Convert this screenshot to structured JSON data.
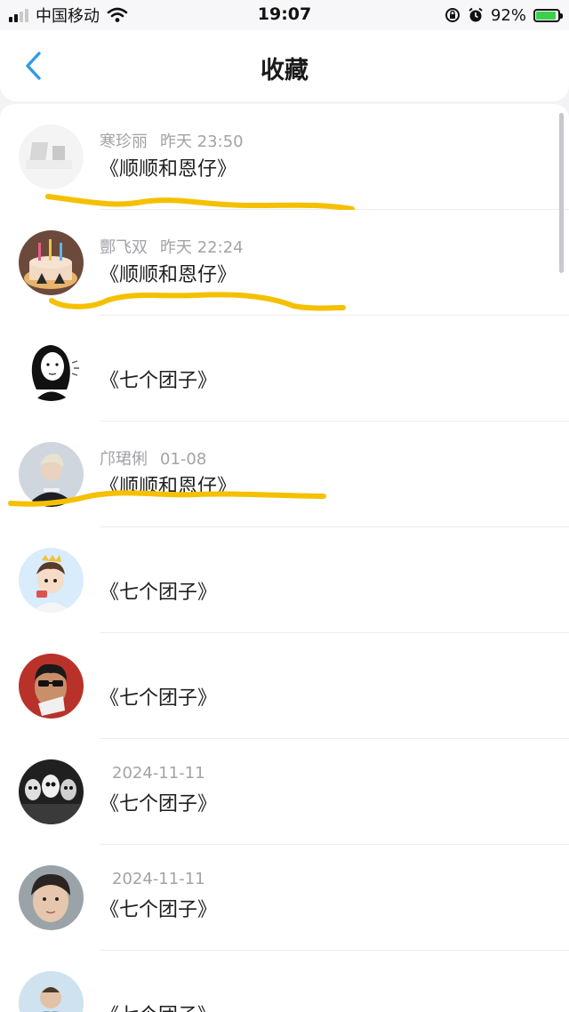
{
  "status_bar": {
    "carrier": "中国移动",
    "time": "19:07",
    "battery": "92%",
    "battery_level": 0.92,
    "icons": [
      "signal-icon",
      "wifi-icon",
      "orientation-lock-icon",
      "alarm-icon",
      "battery-icon"
    ]
  },
  "nav": {
    "title": "收藏",
    "back_icon": "chevron-left-icon",
    "accent": "#2f9be8"
  },
  "favorites": [
    {
      "name": "寒珍丽",
      "time": "昨天 23:50",
      "title": "《顺顺和恩仔》"
    },
    {
      "name": "酆飞双",
      "time": "昨天 22:24",
      "title": "《顺顺和恩仔》"
    },
    {
      "name": "",
      "time": "",
      "title": "《七个团子》"
    },
    {
      "name": "邝珺俐",
      "time": "01-08",
      "title": "《顺顺和恩仔》"
    },
    {
      "name": "",
      "time": "",
      "title": "《七个团子》"
    },
    {
      "name": "",
      "time": "",
      "title": "《七个团子》"
    },
    {
      "name": "",
      "time": "2024-11-11",
      "title": "《七个团子》"
    },
    {
      "name": "",
      "time": "2024-11-11",
      "title": "《七个团子》"
    },
    {
      "name": "",
      "time": "",
      "title": "《七个团子》"
    }
  ],
  "highlight_color": "#f5c000"
}
